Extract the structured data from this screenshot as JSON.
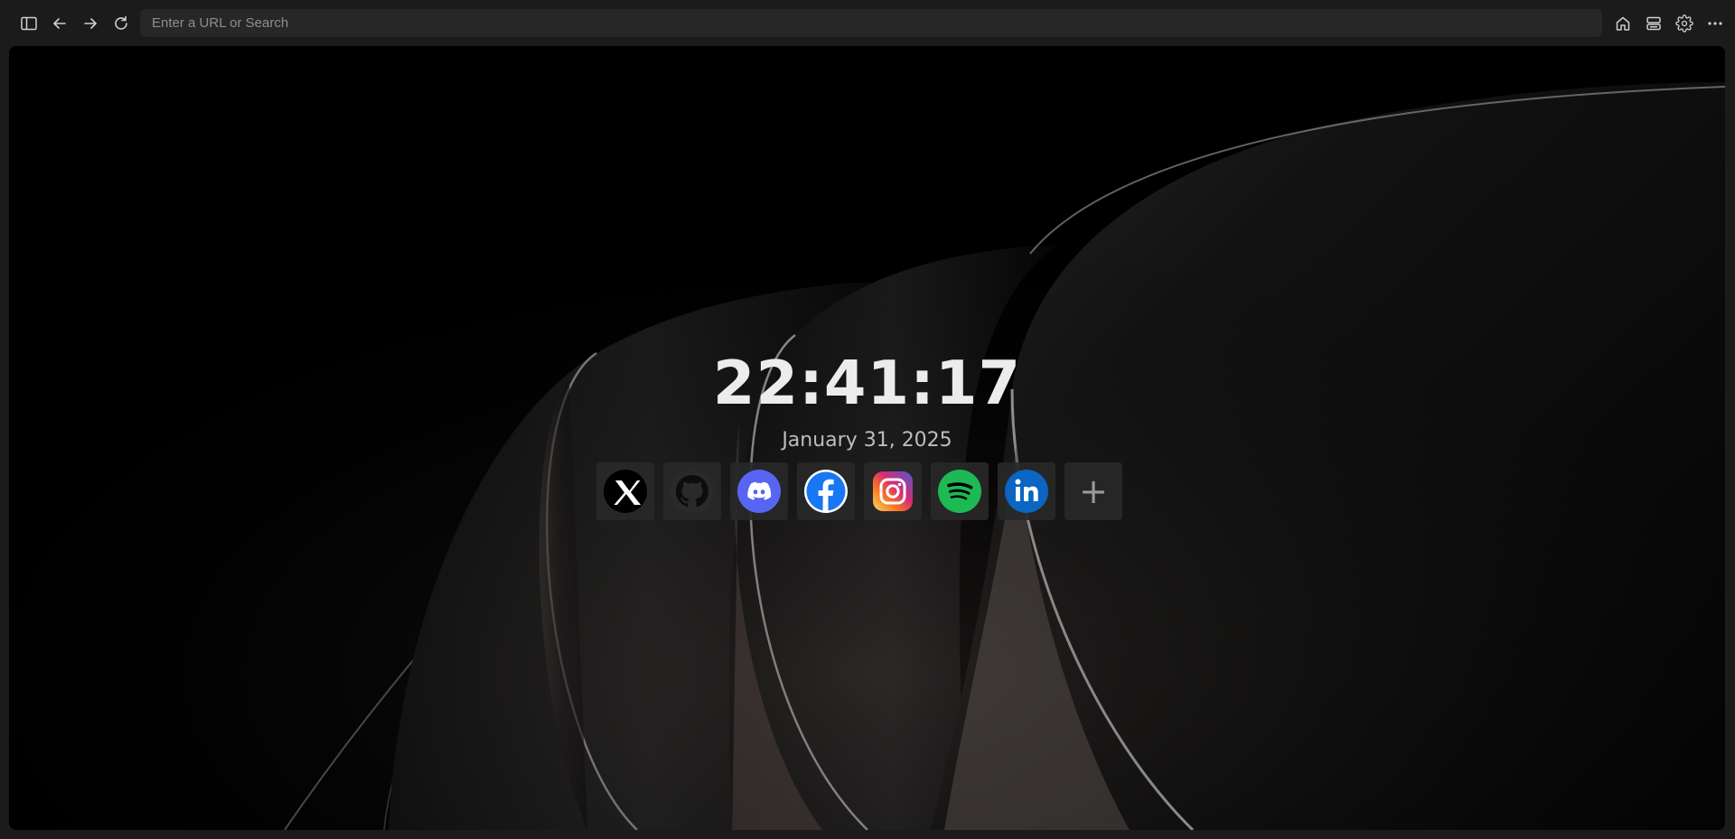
{
  "browser": {
    "url_placeholder": "Enter a URL or Search",
    "url_value": "",
    "toolbar_icons": [
      "sidebar-icon",
      "back-arrow-icon",
      "forward-arrow-icon",
      "reload-icon",
      "home-icon",
      "workspaces-icon",
      "settings-icon",
      "more-icon"
    ]
  },
  "newtab": {
    "time": "22:41:17",
    "date": "January 31, 2025",
    "shortcuts": [
      {
        "name": "X",
        "icon": "x-icon",
        "color": "#000000"
      },
      {
        "name": "GitHub",
        "icon": "github-icon",
        "color": "#2a2a2a"
      },
      {
        "name": "Discord",
        "icon": "discord-icon",
        "color": "#5865F2"
      },
      {
        "name": "Facebook",
        "icon": "facebook-icon",
        "color": "#1877F2"
      },
      {
        "name": "Instagram",
        "icon": "instagram-icon",
        "color": "#E1306C"
      },
      {
        "name": "Spotify",
        "icon": "spotify-icon",
        "color": "#1DB954"
      },
      {
        "name": "LinkedIn",
        "icon": "linkedin-icon",
        "color": "#0A66C2"
      }
    ],
    "add_label": "+"
  }
}
